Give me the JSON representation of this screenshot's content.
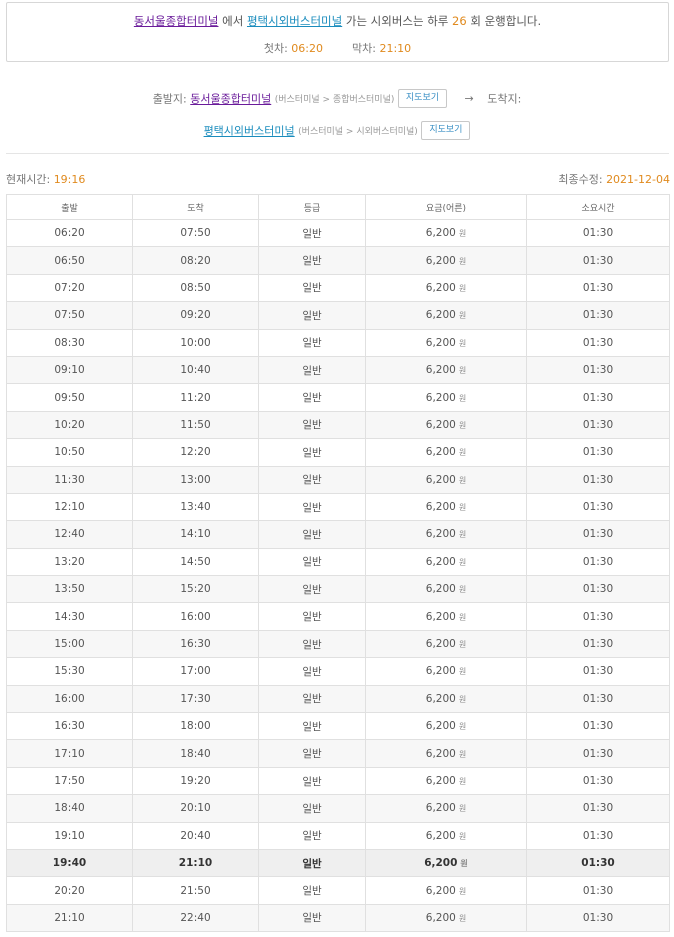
{
  "summary": {
    "origin": "동서울종합터미널",
    "text_from": "에서",
    "destination": "평택시외버스터미널",
    "text_mid": "가는 시외버스는 하루",
    "count": "26",
    "text_end": "회 운행합니다.",
    "first_label": "첫차:",
    "first_time": "06:20",
    "last_label": "막차:",
    "last_time": "21:10"
  },
  "route": {
    "departure_label": "출발지:",
    "departure_name": "동서울종합터미널",
    "departure_path": "(버스터미널 > 종합버스터미널)",
    "map_button": "지도보기",
    "arrow": "→",
    "arrival_label": "도착지:",
    "arrival_name": "평택시외버스터미널",
    "arrival_path": "(버스터미널 > 시외버스터미널)"
  },
  "info": {
    "current_time_label": "현재시간:",
    "current_time": "19:16",
    "updated_label": "최종수정:",
    "updated_date": "2021-12-04"
  },
  "table": {
    "headers": [
      "출발",
      "도착",
      "등급",
      "요금(어른)",
      "소요시간"
    ],
    "currency": "원",
    "current_index": 23,
    "rows": [
      {
        "dep": "06:20",
        "arr": "07:50",
        "grade": "일반",
        "fare": "6,200",
        "dur": "01:30"
      },
      {
        "dep": "06:50",
        "arr": "08:20",
        "grade": "일반",
        "fare": "6,200",
        "dur": "01:30"
      },
      {
        "dep": "07:20",
        "arr": "08:50",
        "grade": "일반",
        "fare": "6,200",
        "dur": "01:30"
      },
      {
        "dep": "07:50",
        "arr": "09:20",
        "grade": "일반",
        "fare": "6,200",
        "dur": "01:30"
      },
      {
        "dep": "08:30",
        "arr": "10:00",
        "grade": "일반",
        "fare": "6,200",
        "dur": "01:30"
      },
      {
        "dep": "09:10",
        "arr": "10:40",
        "grade": "일반",
        "fare": "6,200",
        "dur": "01:30"
      },
      {
        "dep": "09:50",
        "arr": "11:20",
        "grade": "일반",
        "fare": "6,200",
        "dur": "01:30"
      },
      {
        "dep": "10:20",
        "arr": "11:50",
        "grade": "일반",
        "fare": "6,200",
        "dur": "01:30"
      },
      {
        "dep": "10:50",
        "arr": "12:20",
        "grade": "일반",
        "fare": "6,200",
        "dur": "01:30"
      },
      {
        "dep": "11:30",
        "arr": "13:00",
        "grade": "일반",
        "fare": "6,200",
        "dur": "01:30"
      },
      {
        "dep": "12:10",
        "arr": "13:40",
        "grade": "일반",
        "fare": "6,200",
        "dur": "01:30"
      },
      {
        "dep": "12:40",
        "arr": "14:10",
        "grade": "일반",
        "fare": "6,200",
        "dur": "01:30"
      },
      {
        "dep": "13:20",
        "arr": "14:50",
        "grade": "일반",
        "fare": "6,200",
        "dur": "01:30"
      },
      {
        "dep": "13:50",
        "arr": "15:20",
        "grade": "일반",
        "fare": "6,200",
        "dur": "01:30"
      },
      {
        "dep": "14:30",
        "arr": "16:00",
        "grade": "일반",
        "fare": "6,200",
        "dur": "01:30"
      },
      {
        "dep": "15:00",
        "arr": "16:30",
        "grade": "일반",
        "fare": "6,200",
        "dur": "01:30"
      },
      {
        "dep": "15:30",
        "arr": "17:00",
        "grade": "일반",
        "fare": "6,200",
        "dur": "01:30"
      },
      {
        "dep": "16:00",
        "arr": "17:30",
        "grade": "일반",
        "fare": "6,200",
        "dur": "01:30"
      },
      {
        "dep": "16:30",
        "arr": "18:00",
        "grade": "일반",
        "fare": "6,200",
        "dur": "01:30"
      },
      {
        "dep": "17:10",
        "arr": "18:40",
        "grade": "일반",
        "fare": "6,200",
        "dur": "01:30"
      },
      {
        "dep": "17:50",
        "arr": "19:20",
        "grade": "일반",
        "fare": "6,200",
        "dur": "01:30"
      },
      {
        "dep": "18:40",
        "arr": "20:10",
        "grade": "일반",
        "fare": "6,200",
        "dur": "01:30"
      },
      {
        "dep": "19:10",
        "arr": "20:40",
        "grade": "일반",
        "fare": "6,200",
        "dur": "01:30"
      },
      {
        "dep": "19:40",
        "arr": "21:10",
        "grade": "일반",
        "fare": "6,200",
        "dur": "01:30"
      },
      {
        "dep": "20:20",
        "arr": "21:50",
        "grade": "일반",
        "fare": "6,200",
        "dur": "01:30"
      },
      {
        "dep": "21:10",
        "arr": "22:40",
        "grade": "일반",
        "fare": "6,200",
        "dur": "01:30"
      }
    ]
  }
}
